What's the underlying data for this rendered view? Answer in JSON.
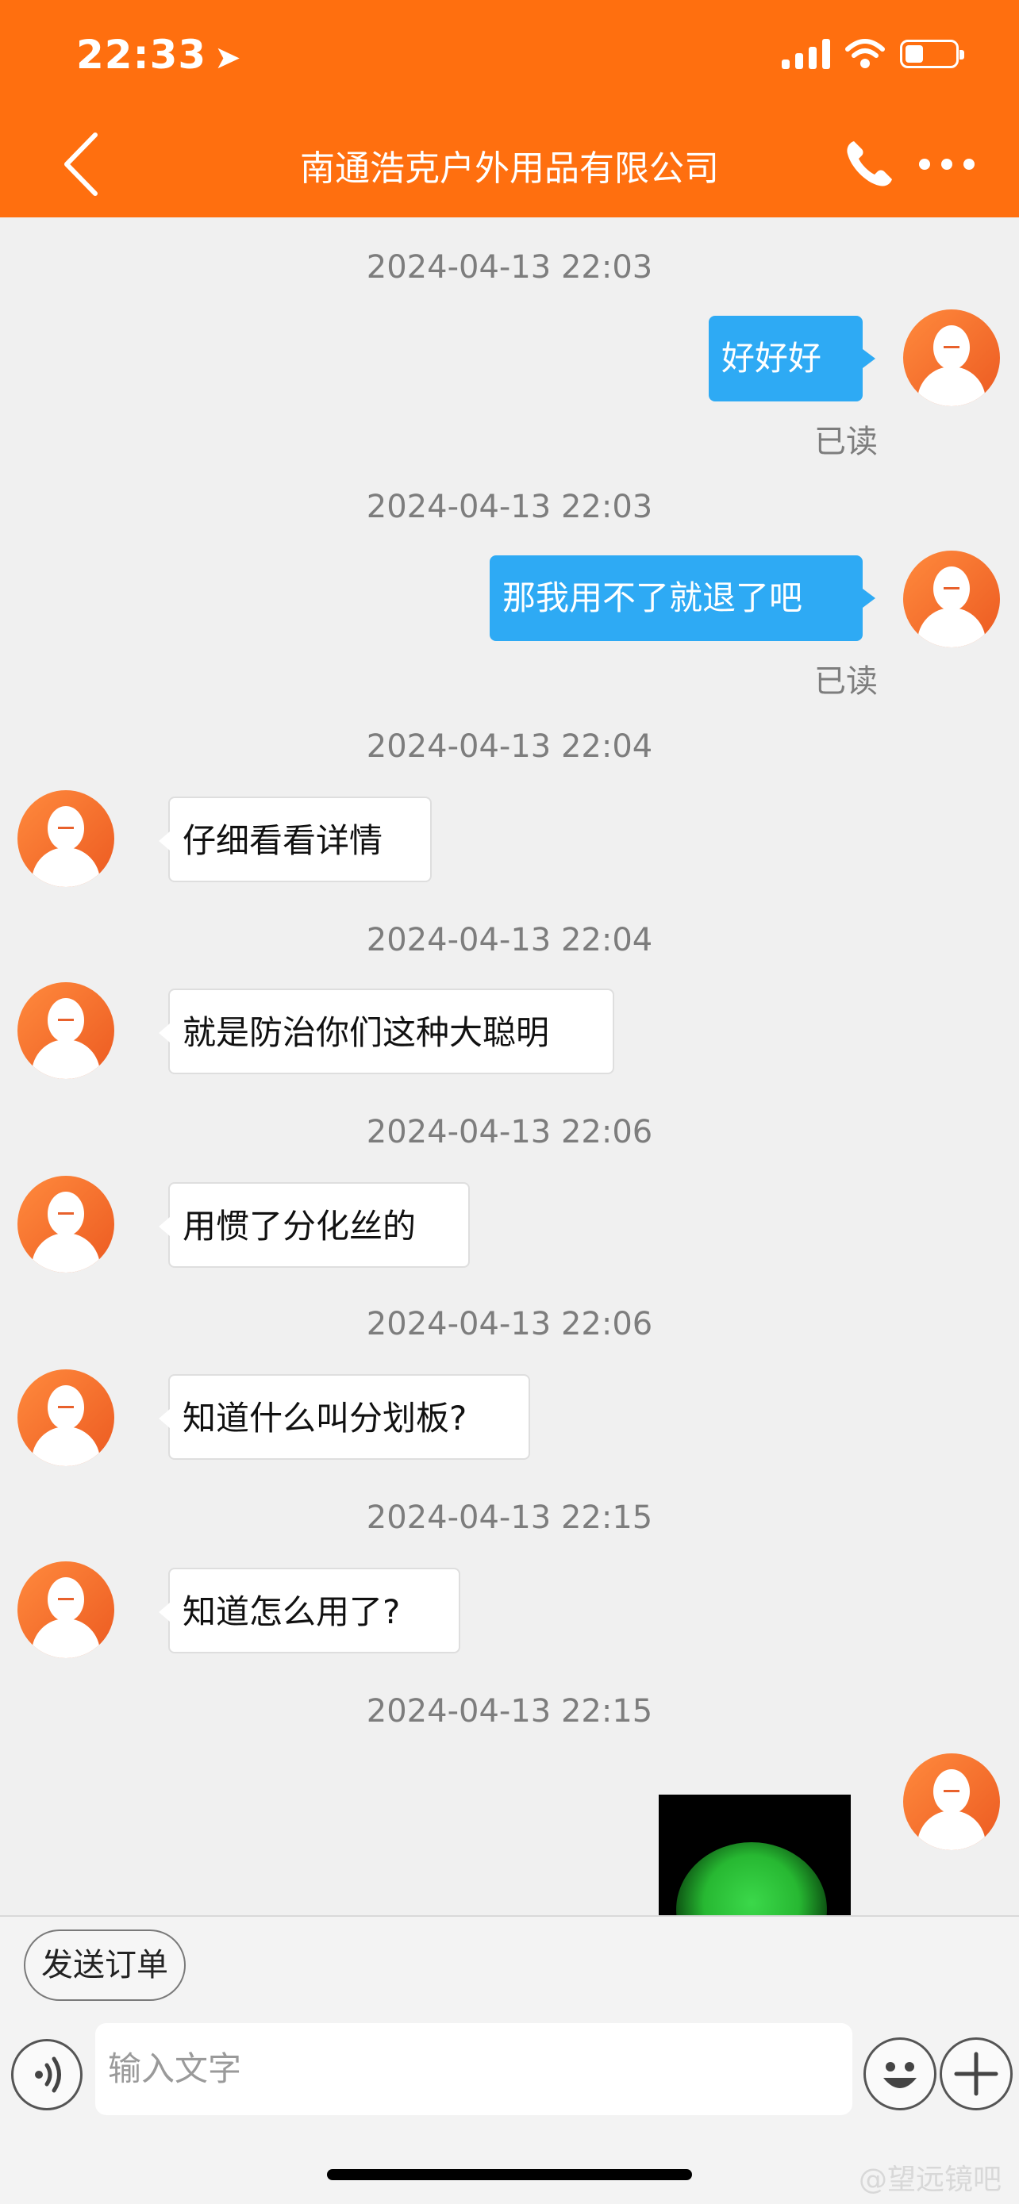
{
  "status_bar": {
    "time": "22:33"
  },
  "header": {
    "title": "南通浩克户外用品有限公司"
  },
  "messages": [
    {
      "timestamp": "2024-04-13 22:03",
      "text": "好好好",
      "read_label": "已读"
    },
    {
      "timestamp": "2024-04-13 22:03",
      "text": "那我用不了就退了吧",
      "read_label": "已读"
    },
    {
      "timestamp": "2024-04-13 22:04",
      "text": "仔细看看详情"
    },
    {
      "timestamp": "2024-04-13 22:04",
      "text": "就是防治你们这种大聪明"
    },
    {
      "timestamp": "2024-04-13 22:06",
      "text": "用惯了分化丝的"
    },
    {
      "timestamp": "2024-04-13 22:06",
      "text": "知道什么叫分划板?"
    },
    {
      "timestamp": "2024-04-13 22:15",
      "text": "知道怎么用了?"
    },
    {
      "timestamp": "2024-04-13 22:15"
    }
  ],
  "bottom": {
    "send_order_label": "发送订单",
    "input_placeholder": "输入文字"
  },
  "watermark": "@望远镜吧",
  "colors": {
    "brand": "#ff6f0f",
    "outgoing_bubble": "#2eaaf4",
    "avatar": "#ef6a2a"
  }
}
